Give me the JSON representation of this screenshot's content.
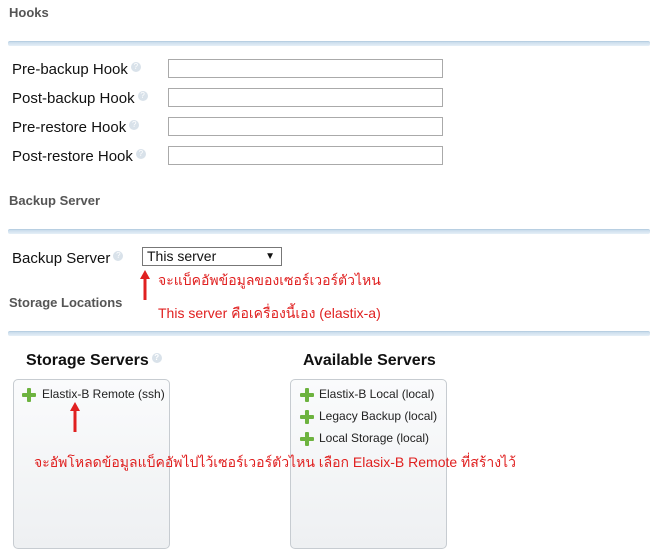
{
  "sections": {
    "hooks": "Hooks",
    "backup_server": "Backup Server",
    "storage_locations": "Storage Locations"
  },
  "hooks": [
    {
      "label": "Pre-backup Hook",
      "value": ""
    },
    {
      "label": "Post-backup Hook",
      "value": ""
    },
    {
      "label": "Pre-restore Hook",
      "value": ""
    },
    {
      "label": "Post-restore Hook",
      "value": ""
    }
  ],
  "backup": {
    "label": "Backup Server",
    "selected": "This server"
  },
  "annotations": {
    "server_question": "จะแบ็คอัพข้อมูลของเซอร์เวอร์ตัวไหน",
    "server_answer": "This server คือเครื่องนี้เอง (elastix-a)",
    "storage_note": "จะอัพโหลดข้อมูลแบ็คอัพไปไว้เซอร์เวอร์ตัวไหน เลือก Elasix-B Remote ที่สร้างไว้"
  },
  "storage": {
    "storage_servers_title": "Storage Servers",
    "available_servers_title": "Available Servers",
    "storage_servers": [
      "Elastix-B Remote (ssh)"
    ],
    "available_servers": [
      "Elastix-B Local (local)",
      "Legacy Backup (local)",
      "Local Storage (local)"
    ]
  },
  "colors": {
    "annotation": "#e02020",
    "add_icon": "#6db33f",
    "separator": "#c9dcec"
  },
  "icons": {
    "help": "help-icon",
    "add": "plus-icon",
    "arrow": "arrow-up-icon"
  }
}
